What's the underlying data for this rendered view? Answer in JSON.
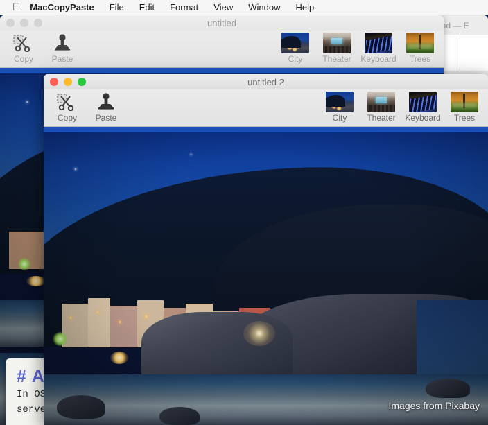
{
  "menubar": {
    "apple_icon": "apple-logo-icon",
    "app_name": "MacCopyPaste",
    "items": [
      "File",
      "Edit",
      "Format",
      "View",
      "Window",
      "Help"
    ]
  },
  "background": {
    "editor_left": {
      "heading": "# A",
      "line1": "In OS",
      "line2": "serve"
    },
    "editor_right": {
      "title": "x.md — E"
    }
  },
  "window_back": {
    "title": "untitled",
    "state": "inactive",
    "traffic_lights": [
      "close-button",
      "minimize-button",
      "zoom-button"
    ],
    "toolbar": {
      "copy_label": "Copy",
      "copy_icon": "scissors-icon",
      "paste_label": "Paste",
      "paste_icon": "stamp-icon"
    },
    "thumbnails": [
      {
        "label": "City",
        "icon": "city-thumbnail"
      },
      {
        "label": "Theater",
        "icon": "theater-thumbnail"
      },
      {
        "label": "Keyboard",
        "icon": "keyboard-thumbnail"
      },
      {
        "label": "Trees",
        "icon": "trees-thumbnail"
      }
    ]
  },
  "window_front": {
    "title": "untitled 2",
    "state": "active",
    "traffic_lights": [
      "close-button",
      "minimize-button",
      "zoom-button"
    ],
    "toolbar": {
      "copy_label": "Copy",
      "copy_icon": "scissors-icon",
      "paste_label": "Paste",
      "paste_icon": "stamp-icon"
    },
    "thumbnails": [
      {
        "label": "City",
        "icon": "city-thumbnail"
      },
      {
        "label": "Theater",
        "icon": "theater-thumbnail"
      },
      {
        "label": "Keyboard",
        "icon": "keyboard-thumbnail"
      },
      {
        "label": "Trees",
        "icon": "trees-thumbnail"
      }
    ],
    "image": {
      "caption": "Images from Pixabay",
      "subject": "night coastal village on cliff"
    }
  },
  "colors": {
    "menubar_bg": "#f6f6f6",
    "toolbar_bg": "#e8e8e8",
    "accent_blue": "#1b50b8",
    "light_red": "#ff5f57",
    "light_yellow": "#febc2e",
    "light_green": "#28c840",
    "md_heading": "#5a63c8"
  }
}
